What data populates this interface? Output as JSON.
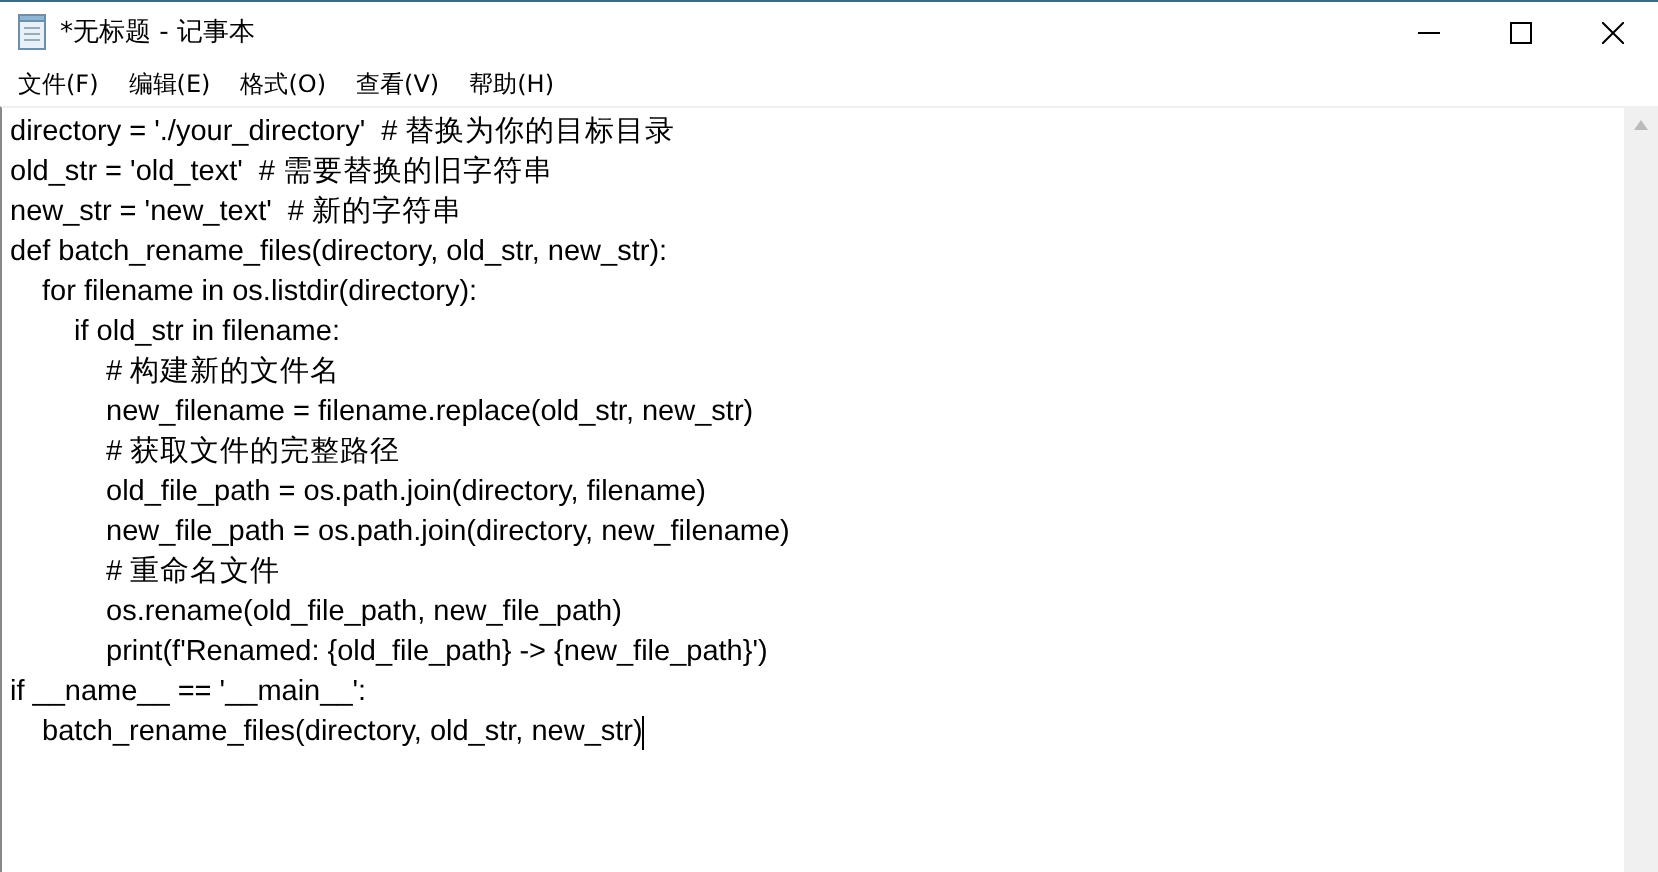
{
  "window": {
    "title": "*无标题 - 记事本"
  },
  "menu": [
    "文件(F)",
    "编辑(E)",
    "格式(O)",
    "查看(V)",
    "帮助(H)"
  ],
  "editor": {
    "lines": [
      {
        "text": "directory = './your_directory'  # 替换为你的目标目录"
      },
      {
        "text": "old_str = 'old_text'  # 需要替换的旧字符串"
      },
      {
        "text": "new_str = 'new_text'  # 新的字符串"
      },
      {
        "text": "def batch_rename_files(directory, old_str, new_str):",
        "children": [
          {
            "text": "for filename in os.listdir(directory):",
            "children": [
              {
                "text": "if old_str in filename:",
                "children": [
                  {
                    "text": "# 构建新的文件名"
                  },
                  {
                    "text": "new_filename = filename.replace(old_str, new_str)"
                  },
                  {
                    "text": "# 获取文件的完整路径"
                  },
                  {
                    "text": "old_file_path = os.path.join(directory, filename)"
                  },
                  {
                    "text": "new_file_path = os.path.join(directory, new_filename)"
                  },
                  {
                    "text": "# 重命名文件"
                  },
                  {
                    "text": "os.rename(old_file_path, new_file_path)"
                  },
                  {
                    "text": "print(f'Renamed: {old_file_path} -> {new_file_path}')"
                  }
                ]
              }
            ]
          }
        ]
      },
      {
        "text": "if __name__ == '__main__':",
        "children": [
          {
            "text": "batch_rename_files(directory, old_str, new_str)",
            "caret": true
          }
        ]
      }
    ]
  }
}
